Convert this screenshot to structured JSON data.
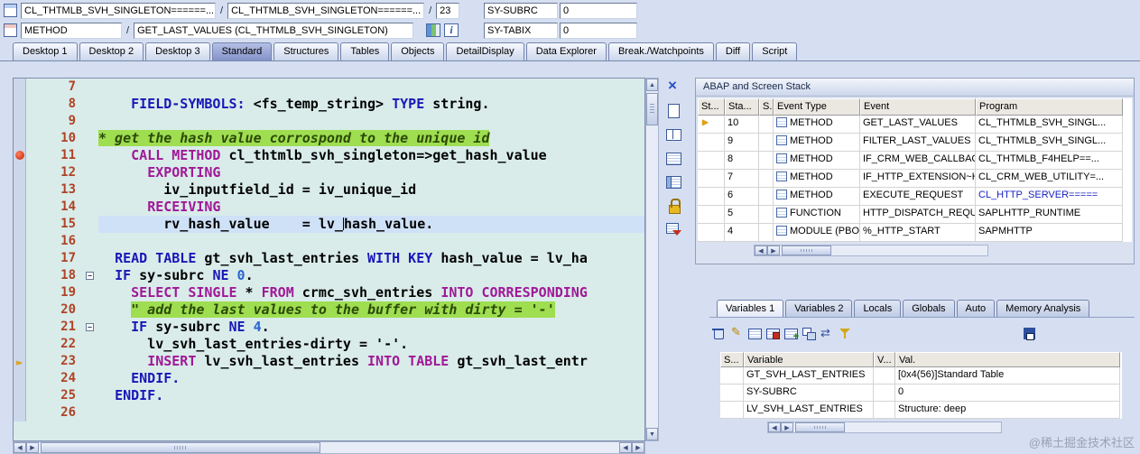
{
  "topbar": {
    "row1": {
      "class_field": "CL_THTMLB_SVH_SINGLETON======...",
      "separator1": "/",
      "include_field": "CL_THTMLB_SVH_SINGLETON======...",
      "separator2": "/",
      "line_number_field": "23",
      "watch_name": "SY-SUBRC",
      "watch_value": "0"
    },
    "row2": {
      "event_kind_field": "METHOD",
      "separator": "/",
      "event_field": "GET_LAST_VALUES (CL_THTMLB_SVH_SINGLETON)",
      "watch_name": "SY-TABIX",
      "watch_value": "0"
    }
  },
  "desktop_tabs": [
    {
      "label": "Desktop 1"
    },
    {
      "label": "Desktop 2"
    },
    {
      "label": "Desktop 3"
    },
    {
      "label": "Standard",
      "active": true
    },
    {
      "label": "Structures"
    },
    {
      "label": "Tables"
    },
    {
      "label": "Objects"
    },
    {
      "label": "DetailDisplay"
    },
    {
      "label": "Data Explorer"
    },
    {
      "label": "Break./Watchpoints"
    },
    {
      "label": "Diff"
    },
    {
      "label": "Script"
    }
  ],
  "editor": {
    "margin_markers": [
      {
        "line": "11",
        "type": "breakpoint"
      },
      {
        "line": "23",
        "type": "arrow"
      }
    ],
    "lines": [
      {
        "n": "7",
        "tokens": []
      },
      {
        "n": "8",
        "tokens": [
          [
            "    ",
            "c"
          ],
          [
            "FIELD-SYMBOLS:",
            "k1"
          ],
          [
            " ",
            "c"
          ],
          [
            "<fs_temp_string>",
            "c"
          ],
          [
            " ",
            "c"
          ],
          [
            "TYPE",
            "k1"
          ],
          [
            " ",
            "c"
          ],
          [
            "string.",
            "c"
          ]
        ]
      },
      {
        "n": "9",
        "tokens": []
      },
      {
        "n": "10",
        "tokens": [
          [
            "* get the hash value corrospond to the unique id",
            "cm"
          ]
        ]
      },
      {
        "n": "11",
        "tokens": [
          [
            "    ",
            "c"
          ],
          [
            "CALL METHOD",
            "k2"
          ],
          [
            " ",
            "c"
          ],
          [
            "cl_thtmlb_svh_singleton=>get_hash_value",
            "c"
          ]
        ]
      },
      {
        "n": "12",
        "tokens": [
          [
            "      ",
            "c"
          ],
          [
            "EXPORTING",
            "k2"
          ]
        ]
      },
      {
        "n": "13",
        "tokens": [
          [
            "        ",
            "c"
          ],
          [
            "iv_inputfield_id = iv_unique_id",
            "c"
          ]
        ]
      },
      {
        "n": "14",
        "tokens": [
          [
            "      ",
            "c"
          ],
          [
            "RECEIVING",
            "k2"
          ]
        ]
      },
      {
        "n": "15",
        "hl": true,
        "tokens": [
          [
            "        ",
            "c"
          ],
          [
            "rv_hash_value    = lv_",
            "c"
          ],
          [
            "",
            "caret"
          ],
          [
            "hash_value.",
            "c"
          ]
        ]
      },
      {
        "n": "16",
        "tokens": []
      },
      {
        "n": "17",
        "tokens": [
          [
            "  ",
            "c"
          ],
          [
            "READ TABLE",
            "k1"
          ],
          [
            " ",
            "c"
          ],
          [
            "gt_svh_last_entries",
            "c"
          ],
          [
            " ",
            "c"
          ],
          [
            "WITH KEY",
            "k1"
          ],
          [
            " ",
            "c"
          ],
          [
            "hash_value = lv_ha",
            "c"
          ]
        ]
      },
      {
        "n": "18",
        "fold": true,
        "tokens": [
          [
            "  ",
            "c"
          ],
          [
            "IF",
            "k1"
          ],
          [
            " ",
            "c"
          ],
          [
            "sy-subrc",
            "c"
          ],
          [
            " ",
            "c"
          ],
          [
            "NE",
            "k1"
          ],
          [
            " ",
            "c"
          ],
          [
            "0",
            "nm"
          ],
          [
            ".",
            "c"
          ]
        ]
      },
      {
        "n": "19",
        "tokens": [
          [
            "    ",
            "c"
          ],
          [
            "SELECT SINGLE",
            "k2"
          ],
          [
            " * ",
            "c"
          ],
          [
            "FROM",
            "k2"
          ],
          [
            " ",
            "c"
          ],
          [
            "crmc_svh_entries",
            "c"
          ],
          [
            " ",
            "c"
          ],
          [
            "INTO CORRESPONDING",
            "k2"
          ]
        ]
      },
      {
        "n": "20",
        "tokens": [
          [
            "    ",
            "c"
          ],
          [
            "\" add the last values to the buffer with dirty = '-'",
            "cm"
          ]
        ]
      },
      {
        "n": "21",
        "fold": true,
        "tokens": [
          [
            "    ",
            "c"
          ],
          [
            "IF",
            "k1"
          ],
          [
            " ",
            "c"
          ],
          [
            "sy-subrc",
            "c"
          ],
          [
            " ",
            "c"
          ],
          [
            "NE",
            "k1"
          ],
          [
            " ",
            "c"
          ],
          [
            "4",
            "nm"
          ],
          [
            ".",
            "c"
          ]
        ]
      },
      {
        "n": "22",
        "tokens": [
          [
            "      ",
            "c"
          ],
          [
            "lv_svh_last_entries-dirty = '-'.",
            "c"
          ]
        ]
      },
      {
        "n": "23",
        "tokens": [
          [
            "      ",
            "c"
          ],
          [
            "INSERT",
            "k2"
          ],
          [
            " ",
            "c"
          ],
          [
            "lv_svh_last_entries",
            "c"
          ],
          [
            " ",
            "c"
          ],
          [
            "INTO TABLE",
            "k2"
          ],
          [
            " ",
            "c"
          ],
          [
            "gt_svh_last_entr",
            "c"
          ]
        ]
      },
      {
        "n": "24",
        "tokens": [
          [
            "    ",
            "c"
          ],
          [
            "ENDIF.",
            "k1"
          ]
        ]
      },
      {
        "n": "25",
        "tokens": [
          [
            "  ",
            "c"
          ],
          [
            "ENDIF.",
            "k1"
          ]
        ]
      },
      {
        "n": "26",
        "tokens": []
      }
    ]
  },
  "side_toolbar": [
    {
      "name": "close"
    },
    {
      "name": "create-session"
    },
    {
      "name": "split-screen"
    },
    {
      "name": "table-view"
    },
    {
      "name": "structure-view"
    },
    {
      "name": "unlock"
    },
    {
      "name": "tools"
    }
  ],
  "stack": {
    "title": "ABAP and Screen Stack",
    "columns": [
      "St...",
      "Sta...",
      "S..",
      "Event Type",
      "Event",
      "Program"
    ],
    "rows": [
      {
        "active": true,
        "level": "10",
        "event_type": "METHOD",
        "event": "GET_LAST_VALUES",
        "program": "CL_THTMLB_SVH_SINGL..."
      },
      {
        "level": "9",
        "event_type": "METHOD",
        "event": "FILTER_LAST_VALUES",
        "program": "CL_THTMLB_SVH_SINGL..."
      },
      {
        "level": "8",
        "event_type": "METHOD",
        "event": "IF_CRM_WEB_CALLBACK...",
        "program": "CL_THTMLB_F4HELP==..."
      },
      {
        "level": "7",
        "event_type": "METHOD",
        "event": "IF_HTTP_EXTENSION~H...",
        "program": "CL_CRM_WEB_UTILITY=..."
      },
      {
        "level": "6",
        "event_type": "METHOD",
        "event": "EXECUTE_REQUEST",
        "program": "CL_HTTP_SERVER=====",
        "program_link": true
      },
      {
        "level": "5",
        "event_type": "FUNCTION",
        "event": "HTTP_DISPATCH_REQU...",
        "program": "SAPLHTTP_RUNTIME"
      },
      {
        "level": "4",
        "event_type": "MODULE (PBO)",
        "event": "%_HTTP_START",
        "program": "SAPMHTTP"
      }
    ]
  },
  "variables_panel": {
    "tabs": [
      {
        "label": "Variables 1",
        "active": true
      },
      {
        "label": "Variables 2"
      },
      {
        "label": "Locals"
      },
      {
        "label": "Globals"
      },
      {
        "label": "Auto"
      },
      {
        "label": "Memory Analysis"
      }
    ],
    "toolbar": [
      {
        "name": "delete"
      },
      {
        "name": "change"
      },
      {
        "name": "table"
      },
      {
        "name": "save-list"
      },
      {
        "name": "insert"
      },
      {
        "name": "compare"
      },
      {
        "name": "swap"
      },
      {
        "name": "filter"
      }
    ],
    "save_icon": "save",
    "columns": [
      "S...",
      "Variable",
      "V...",
      "Val."
    ],
    "rows": [
      {
        "variable": "GT_SVH_LAST_ENTRIES",
        "value": "[0x4(56)]Standard Table"
      },
      {
        "variable": "SY-SUBRC",
        "value": "0"
      },
      {
        "variable": "LV_SVH_LAST_ENTRIES",
        "value": "Structure: deep"
      }
    ]
  },
  "watermark": "@稀土掘金技术社区"
}
